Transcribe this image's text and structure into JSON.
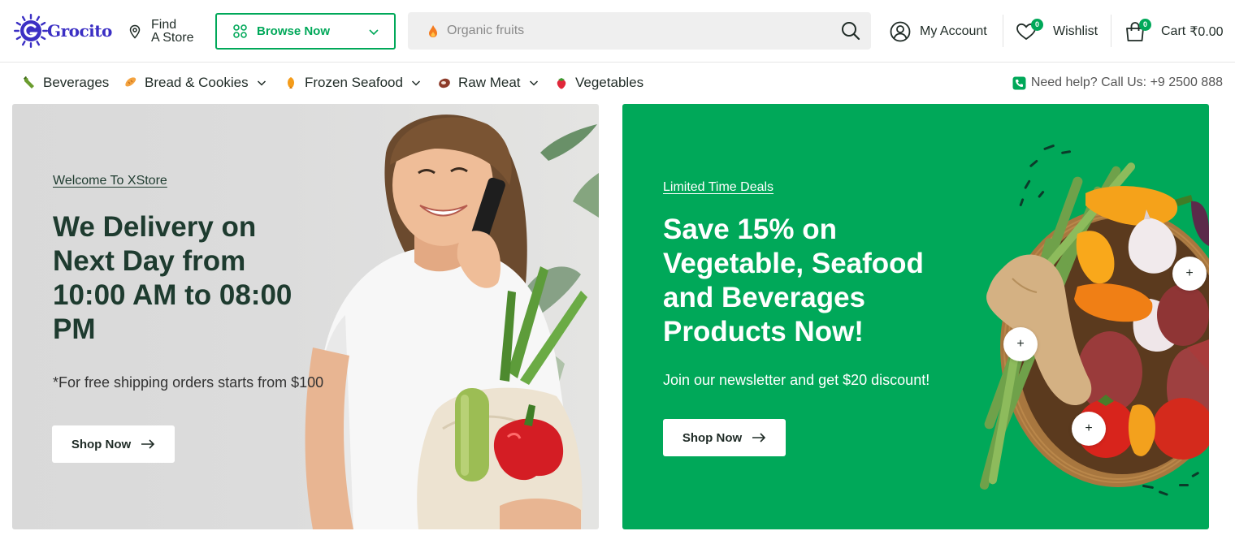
{
  "brand": {
    "name": "Grocito",
    "accent": "#00a859",
    "logo_color": "#3b2fc4"
  },
  "header": {
    "find_store": {
      "line1": "Find",
      "line2": "A Store"
    },
    "browse_label": "Browse Now",
    "search": {
      "placeholder": "Organic fruits"
    },
    "account_label": "My Account",
    "wishlist": {
      "label": "Wishlist",
      "count": "0"
    },
    "cart": {
      "label": "Cart",
      "total": "₹0.00",
      "count": "0"
    }
  },
  "nav": {
    "items": [
      {
        "label": "Beverages",
        "icon": "bottle-icon",
        "has_dropdown": false
      },
      {
        "label": "Bread & Cookies",
        "icon": "bread-icon",
        "has_dropdown": true
      },
      {
        "label": "Frozen Seafood",
        "icon": "seafood-icon",
        "has_dropdown": true
      },
      {
        "label": "Raw Meat",
        "icon": "meat-icon",
        "has_dropdown": true
      },
      {
        "label": "Vegetables",
        "icon": "strawberry-icon",
        "has_dropdown": false
      }
    ],
    "help_text": "Need help? Call Us: +9 2500 888"
  },
  "banners": {
    "left": {
      "eyebrow": "Welcome To XStore",
      "headline": [
        "We Delivery on",
        "Next Day from",
        "10:00 AM to 08:00",
        "PM"
      ],
      "subline": "*For free shipping orders starts from $100",
      "button": "Shop Now"
    },
    "right": {
      "eyebrow": "Limited Time Deals",
      "headline": [
        "Save 15% on",
        "Vegetable, Seafood",
        "and Beverages",
        "Products Now!"
      ],
      "subline": "Join our newsletter and get $20 discount!",
      "button": "Shop Now",
      "hotspot_label": "+"
    }
  }
}
